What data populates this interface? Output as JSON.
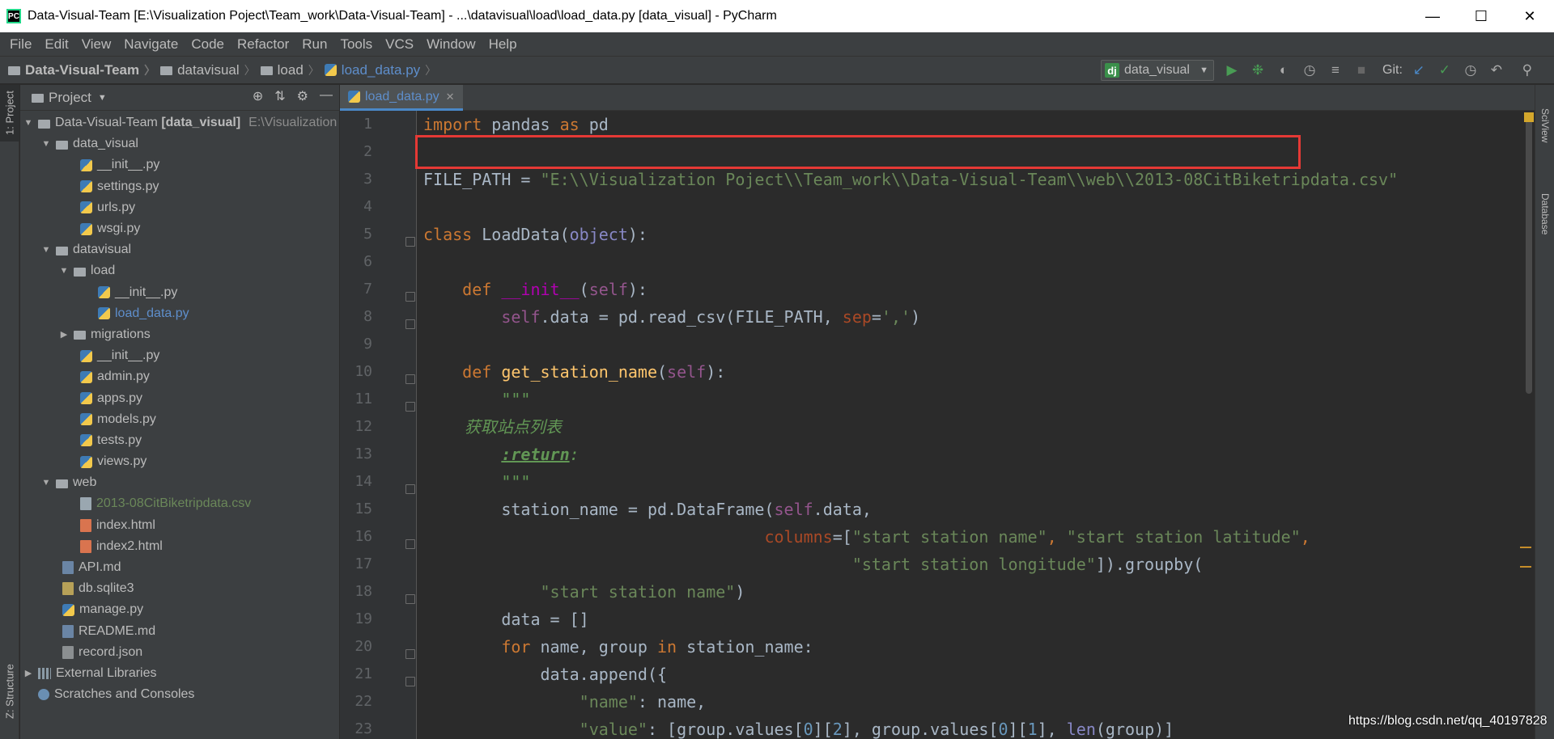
{
  "window": {
    "title": "Data-Visual-Team [E:\\Visualization Poject\\Team_work\\Data-Visual-Team] - ...\\datavisual\\load\\load_data.py [data_visual] - PyCharm",
    "app_icon": "PC"
  },
  "menu": [
    "File",
    "Edit",
    "View",
    "Navigate",
    "Code",
    "Refactor",
    "Run",
    "Tools",
    "VCS",
    "Window",
    "Help"
  ],
  "breadcrumb": [
    "Data-Visual-Team",
    "datavisual",
    "load",
    "load_data.py"
  ],
  "toolbar": {
    "run_config": "data_visual",
    "git_label": "Git:"
  },
  "left_tabs": {
    "project": "1: Project",
    "structure": "Z: Structure"
  },
  "right_tabs": {
    "sciview": "SciView",
    "database": "Database"
  },
  "project_panel": {
    "title": "Project",
    "tree": [
      {
        "label": "Data-Visual-Team",
        "ctx": "[data_visual]",
        "hint": "E:\\Visualization"
      },
      {
        "label": "data_visual"
      },
      {
        "label": "__init__.py"
      },
      {
        "label": "settings.py"
      },
      {
        "label": "urls.py"
      },
      {
        "label": "wsgi.py"
      },
      {
        "label": "datavisual"
      },
      {
        "label": "load"
      },
      {
        "label": "__init__.py"
      },
      {
        "label": "load_data.py"
      },
      {
        "label": "migrations"
      },
      {
        "label": "__init__.py"
      },
      {
        "label": "admin.py"
      },
      {
        "label": "apps.py"
      },
      {
        "label": "models.py"
      },
      {
        "label": "tests.py"
      },
      {
        "label": "views.py"
      },
      {
        "label": "web"
      },
      {
        "label": "2013-08CitBiketripdata.csv"
      },
      {
        "label": "index.html"
      },
      {
        "label": "index2.html"
      },
      {
        "label": "API.md"
      },
      {
        "label": "db.sqlite3"
      },
      {
        "label": "manage.py"
      },
      {
        "label": "README.md"
      },
      {
        "label": "record.json"
      },
      {
        "label": "External Libraries"
      },
      {
        "label": "Scratches and Consoles"
      }
    ]
  },
  "editor": {
    "tab": "load_data.py",
    "line_numbers": [
      "1",
      "2",
      "3",
      "4",
      "5",
      "6",
      "7",
      "8",
      "9",
      "10",
      "11",
      "12",
      "13",
      "14",
      "15",
      "16",
      "17",
      "18",
      "19",
      "20",
      "21",
      "22",
      "23"
    ],
    "code": {
      "l1": {
        "a": "import",
        "b": " pandas ",
        "c": "as",
        "d": " pd"
      },
      "l3": {
        "a": "FILE_PATH = ",
        "b": "\"E:\\\\Visualization Poject\\\\Team_work\\\\Data-Visual-Team\\\\web\\\\2013-08CitBiketripdata.csv\""
      },
      "l5": {
        "a": "class",
        "b": " LoadData(",
        "c": "object",
        "d": "):"
      },
      "l7": {
        "a": "    ",
        "b": "def",
        "c": " ",
        "d": "__init__",
        "e": "(",
        "f": "self",
        "g": "):"
      },
      "l8": {
        "a": "        ",
        "b": "self",
        "c": ".data = pd.read_csv(FILE_PATH, ",
        "d": "sep",
        "e": "=",
        "f": "','",
        "g": ")"
      },
      "l10": {
        "a": "    ",
        "b": "def",
        "c": " ",
        "d": "get_station_name",
        "e": "(",
        "f": "self",
        "g": "):"
      },
      "l11": "        \"\"\"",
      "l12": "        获取站点列表",
      "l13": {
        "a": "        ",
        "b": ":return",
        "c": ":"
      },
      "l14": "        \"\"\"",
      "l15": {
        "a": "        station_name = pd.DataFrame(",
        "b": "self",
        "c": ".data,"
      },
      "l16": {
        "a": "                                   ",
        "b": "columns",
        "c": "=[",
        "d": "\"start station name\"",
        "e": ", ",
        "f": "\"start station latitude\"",
        "g": ","
      },
      "l17": {
        "a": "                                            ",
        "b": "\"start station longitude\"",
        "c": "]).groupby("
      },
      "l18": {
        "a": "            ",
        "b": "\"start station name\"",
        "c": ")"
      },
      "l19": "        data = []",
      "l20": {
        "a": "        ",
        "b": "for",
        "c": " name, group ",
        "d": "in",
        "e": " station_name:"
      },
      "l21": "            data.append({",
      "l22": {
        "a": "                ",
        "b": "\"name\"",
        "c": ": name,"
      },
      "l23": {
        "a": "                ",
        "b": "\"value\"",
        "c": ": [group.values[",
        "d": "0",
        "e": "][",
        "f": "2",
        "g": "], group.values[",
        "h": "0",
        "i": "][",
        "j": "1",
        "k": "], ",
        "l": "len",
        "m": "(group)]"
      }
    }
  },
  "watermark": "https://blog.csdn.net/qq_40197828"
}
